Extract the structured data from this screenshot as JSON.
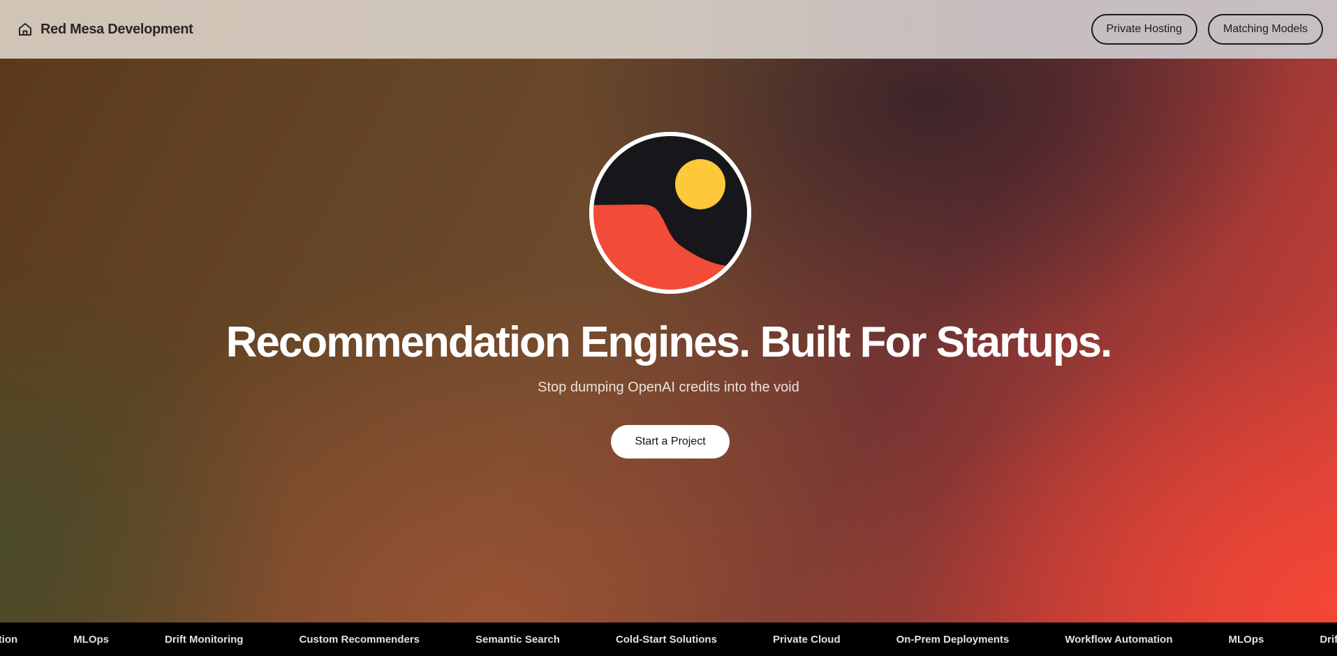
{
  "header": {
    "brand_name": "Red Mesa Development",
    "brand_icon": "home-icon",
    "nav": [
      {
        "label": "Private Hosting"
      },
      {
        "label": "Matching Models"
      }
    ]
  },
  "hero": {
    "logo_icon": "sunset-landscape-logo",
    "headline": "Recommendation Engines. Built For Startups.",
    "subtitle": "Stop dumping OpenAI credits into the void",
    "cta_label": "Start a Project"
  },
  "ticker": {
    "items": [
      "Workflow Automation",
      "MLOps",
      "Drift Monitoring",
      "Custom Recommenders",
      "Semantic Search",
      "Cold-Start Solutions",
      "Private Cloud",
      "On-Prem Deployments",
      "Workflow Automation",
      "MLOps",
      "Drift Monitoring"
    ]
  },
  "colors": {
    "logo_dark": "#17171b",
    "logo_sun": "#fdc93a",
    "logo_mesa": "#f24b37",
    "ticker_bg": "#000000"
  }
}
